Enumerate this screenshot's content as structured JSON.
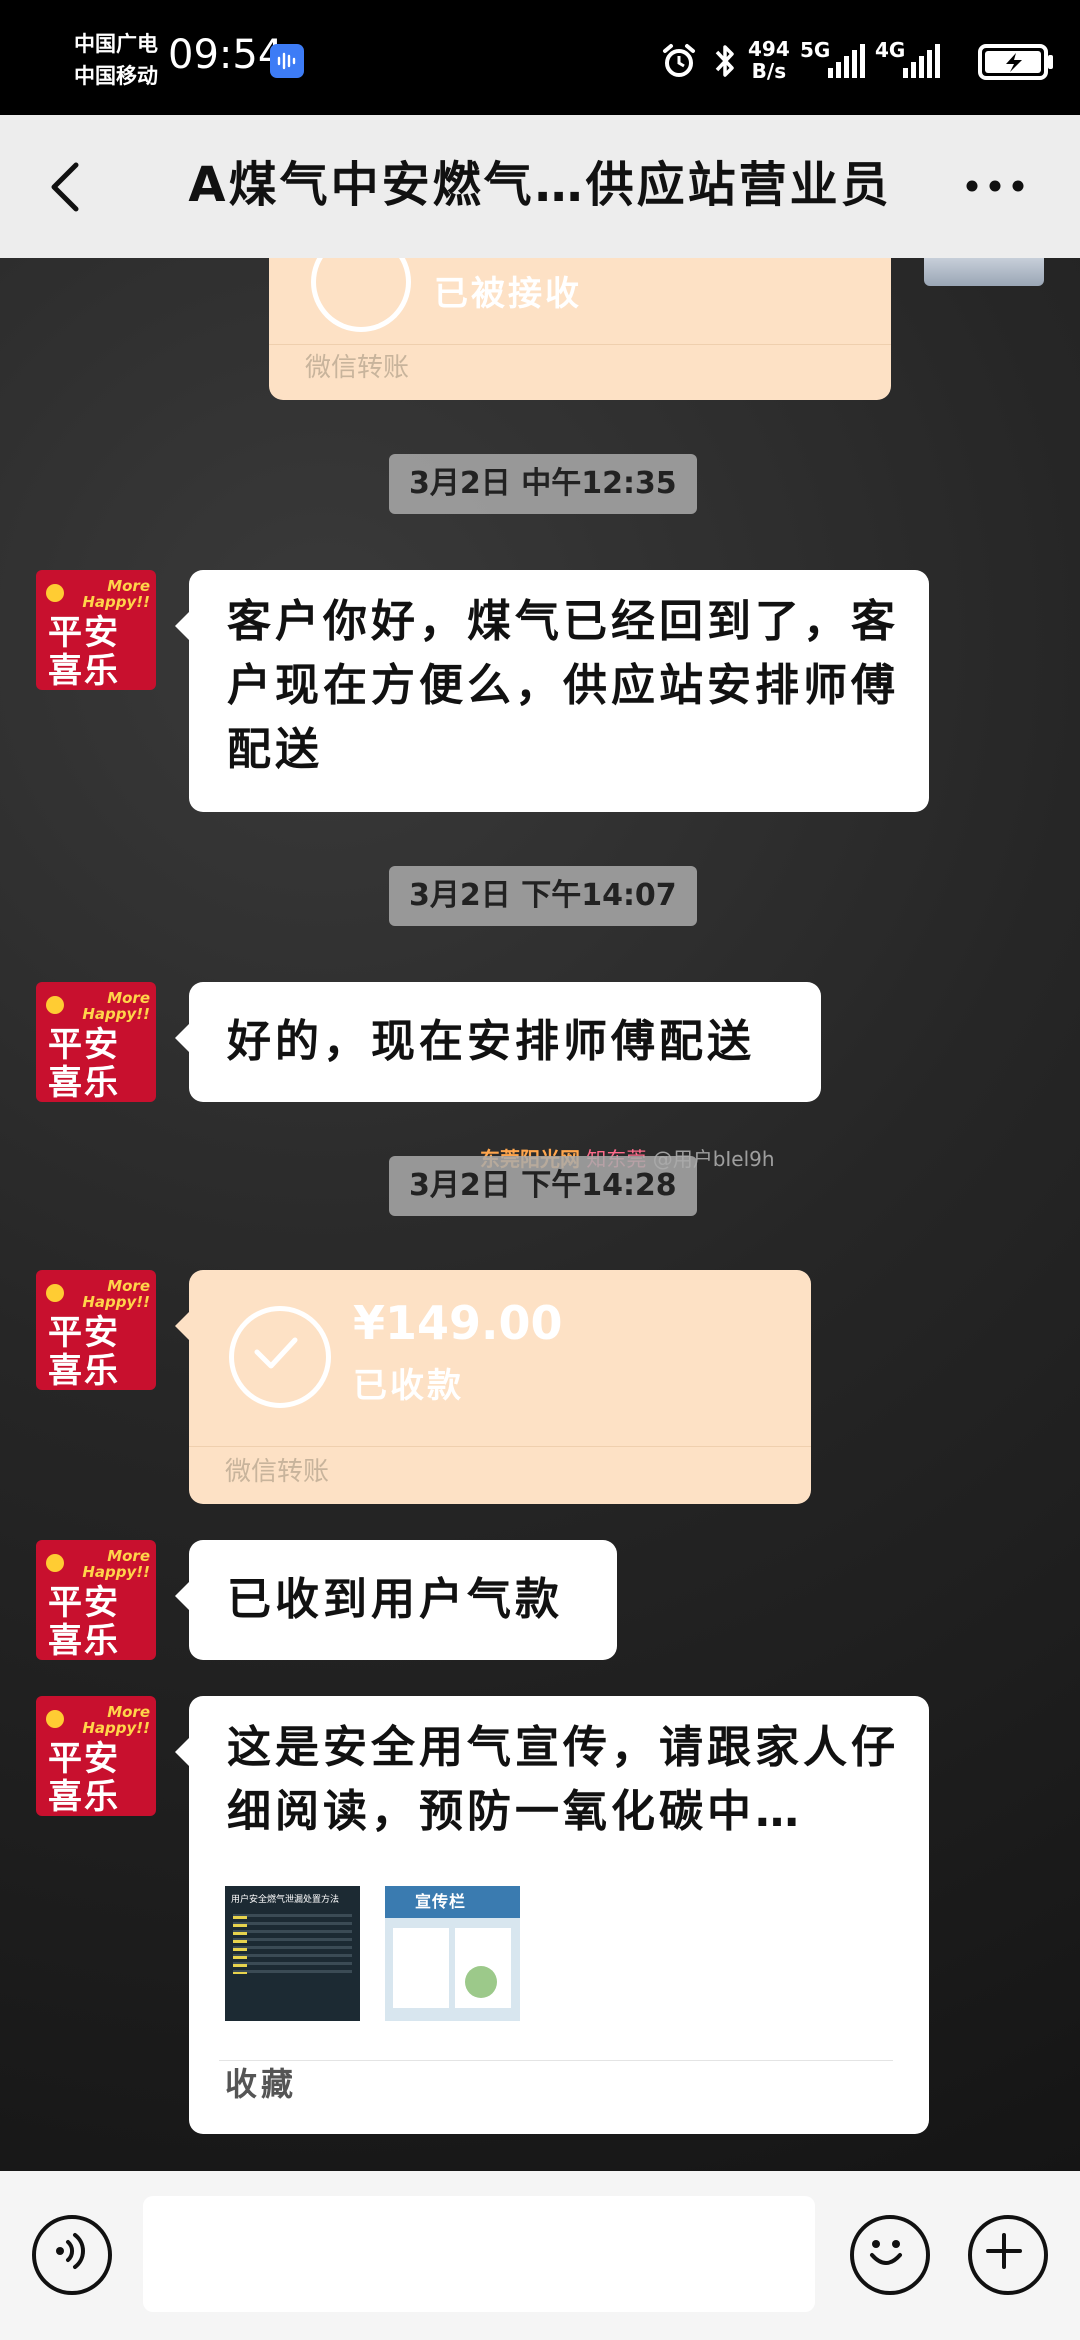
{
  "status_bar": {
    "carrier_1": "中国广电",
    "carrier_2": "中国移动",
    "time": "09:54",
    "net_speed_value": "494",
    "net_speed_unit": "B/s",
    "network_1": "5G",
    "network_2": "4G",
    "icons": [
      "alarm-icon",
      "bluetooth-icon",
      "signal-5g-icon",
      "signal-4g-icon",
      "battery-charging-icon"
    ]
  },
  "header": {
    "title": "A煤气中安燃气…供应站营业员"
  },
  "chat": {
    "top_transfer": {
      "status": "已被接收",
      "footer": "微信转账"
    },
    "timestamps": [
      "3月2日 中午12:35",
      "3月2日 下午14:07",
      "3月2日 下午14:28"
    ],
    "avatar": {
      "top_text": "More Happy!!",
      "main_text_1": "平安",
      "main_text_2": "喜乐"
    },
    "messages": [
      {
        "text": "客户你好，煤气已经回到了，客户现在方便么，供应站安排师傅配送"
      },
      {
        "text": "好的，现在安排师傅配送"
      },
      {
        "text": "已收到用户气款"
      }
    ],
    "transfer": {
      "amount": "¥149.00",
      "status": "已收款",
      "footer": "微信转账"
    },
    "watermark": {
      "part_1": "东莞阳光网",
      "part_2": "知东莞",
      "part_3": "@用户bIel9h"
    },
    "card": {
      "text": "这是安全用气宣传，请跟家人仔细阅读，预防一氧化碳中…",
      "image_1_title": "用户安全燃气泄漏处置方法",
      "image_2_title": "宣传栏",
      "footer": "收藏"
    }
  },
  "input_bar": {
    "placeholder": ""
  }
}
